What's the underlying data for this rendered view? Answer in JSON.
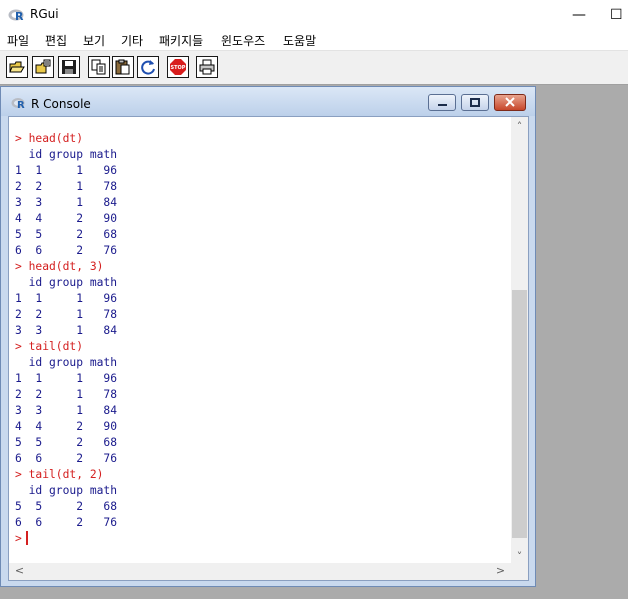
{
  "app": {
    "title": "RGui",
    "minimize_glyph": "—",
    "maximize_glyph": "☐"
  },
  "menu": [
    "파일",
    "편집",
    "보기",
    "기타",
    "패키지들",
    "윈도우즈",
    "도움말"
  ],
  "toolbar": {
    "buttons": [
      "open-script-icon",
      "load-workspace-icon",
      "save-icon",
      "copy-icon",
      "paste-icon",
      "refresh-icon",
      "stop-icon",
      "print-icon"
    ],
    "stop_label": "STOP",
    "stop_color": "#d81d1d"
  },
  "console": {
    "title": "R Console",
    "prompt": ">",
    "input_color": "#d42020",
    "output_color": "#1a1a8c",
    "lines": [
      {
        "type": "input",
        "text": "> head(dt)"
      },
      {
        "type": "output",
        "text": "  id group math"
      },
      {
        "type": "output",
        "text": "1  1     1   96"
      },
      {
        "type": "output",
        "text": "2  2     1   78"
      },
      {
        "type": "output",
        "text": "3  3     1   84"
      },
      {
        "type": "output",
        "text": "4  4     2   90"
      },
      {
        "type": "output",
        "text": "5  5     2   68"
      },
      {
        "type": "output",
        "text": "6  6     2   76"
      },
      {
        "type": "input",
        "text": "> head(dt, 3)"
      },
      {
        "type": "output",
        "text": "  id group math"
      },
      {
        "type": "output",
        "text": "1  1     1   96"
      },
      {
        "type": "output",
        "text": "2  2     1   78"
      },
      {
        "type": "output",
        "text": "3  3     1   84"
      },
      {
        "type": "input",
        "text": "> tail(dt)"
      },
      {
        "type": "output",
        "text": "  id group math"
      },
      {
        "type": "output",
        "text": "1  1     1   96"
      },
      {
        "type": "output",
        "text": "2  2     1   78"
      },
      {
        "type": "output",
        "text": "3  3     1   84"
      },
      {
        "type": "output",
        "text": "4  4     2   90"
      },
      {
        "type": "output",
        "text": "5  5     2   68"
      },
      {
        "type": "output",
        "text": "6  6     2   76"
      },
      {
        "type": "input",
        "text": "> tail(dt, 2)"
      },
      {
        "type": "output",
        "text": "  id group math"
      },
      {
        "type": "output",
        "text": "5  5     2   68"
      },
      {
        "type": "output",
        "text": "6  6     2   76"
      }
    ]
  }
}
